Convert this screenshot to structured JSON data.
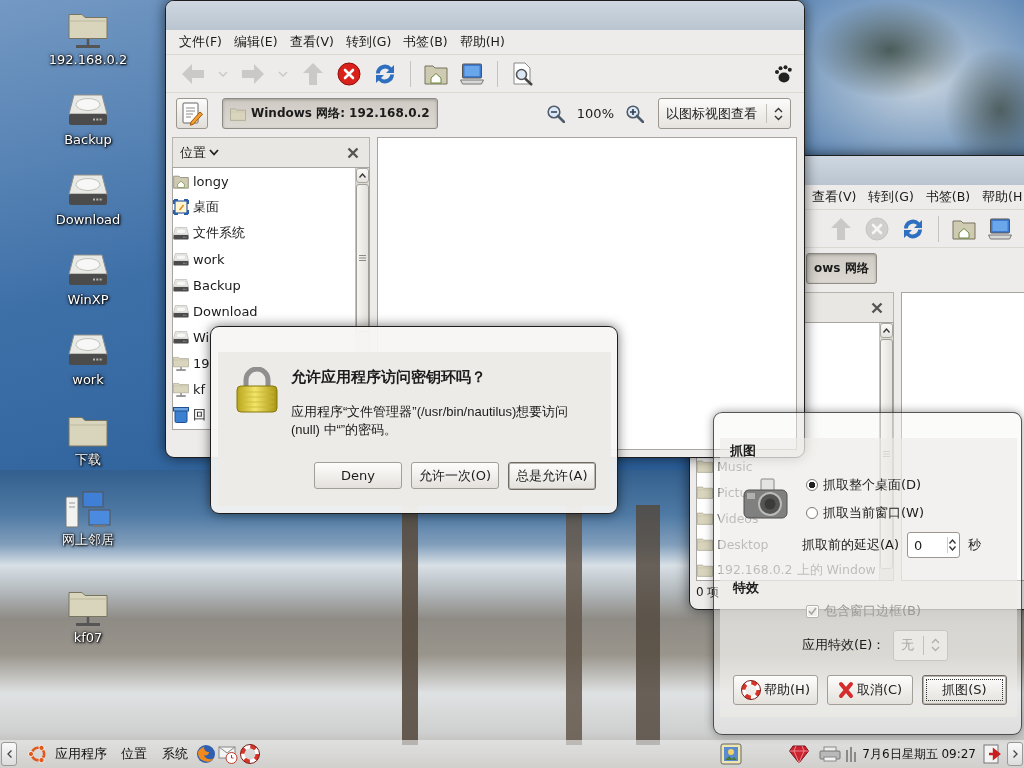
{
  "desktop": {
    "icons": [
      {
        "label": "192.168.0.2",
        "kind": "network-folder"
      },
      {
        "label": "Backup",
        "kind": "drive"
      },
      {
        "label": "Download",
        "kind": "drive"
      },
      {
        "label": "WinXP",
        "kind": "drive"
      },
      {
        "label": "work",
        "kind": "drive"
      },
      {
        "label": "下载",
        "kind": "folder"
      },
      {
        "label": "网上邻居",
        "kind": "network"
      },
      {
        "label": "kf07",
        "kind": "network-folder"
      }
    ]
  },
  "file_manager": {
    "menu": [
      "文件(F)",
      "编辑(E)",
      "查看(V)",
      "转到(G)",
      "书签(B)",
      "帮助(H)"
    ],
    "toolbar": [
      [
        {
          "kind": "back",
          "disabled": true
        },
        {
          "kind": "back-menu",
          "disabled": true
        },
        {
          "kind": "forward",
          "disabled": true
        },
        {
          "kind": "forward-menu",
          "disabled": true
        },
        {
          "kind": "up",
          "disabled": true
        },
        {
          "kind": "stop",
          "disabled": false
        },
        {
          "kind": "reload",
          "disabled": false
        }
      ],
      [
        {
          "kind": "home",
          "disabled": false
        },
        {
          "kind": "computer",
          "disabled": false
        }
      ],
      [
        {
          "kind": "search",
          "disabled": false
        }
      ]
    ],
    "path_button": {
      "label": "Windows 网络: 192.168.0.2",
      "selected": true
    },
    "zoom": "100%",
    "view_mode": "以图标视图查看",
    "sidebar": {
      "title": "位置",
      "items": [
        {
          "label": "longy",
          "kind": "home"
        },
        {
          "label": "桌面",
          "kind": "desktop"
        },
        {
          "label": "文件系统",
          "kind": "drive"
        },
        {
          "label": "work",
          "kind": "drive"
        },
        {
          "label": "Backup",
          "kind": "drive"
        },
        {
          "label": "Download",
          "kind": "drive"
        },
        {
          "label": "Wi",
          "kind": "drive"
        },
        {
          "label": "19",
          "kind": "network-folder"
        },
        {
          "label": "kf",
          "kind": "network-folder"
        },
        {
          "label": "回",
          "kind": "trash"
        }
      ]
    }
  },
  "back_window": {
    "menu": [
      "查看(V)",
      "转到(G)",
      "书签(B)",
      "帮助(H"
    ],
    "toolbar": [
      [
        {
          "kind": "up",
          "disabled": true
        },
        {
          "kind": "stop",
          "disabled": true
        },
        {
          "kind": "reload",
          "disabled": false
        }
      ],
      [
        {
          "kind": "home",
          "disabled": false
        },
        {
          "kind": "computer",
          "disabled": false
        }
      ]
    ],
    "path_button": {
      "label": "ows 网络",
      "selected": true
    },
    "sidebar_items": [
      {
        "label": "Music",
        "kind": "folder"
      },
      {
        "label": "Pictu",
        "kind": "folder"
      },
      {
        "label": "Videos",
        "kind": "folder"
      },
      {
        "label": "Desktop",
        "kind": "folder"
      },
      {
        "label": "192.168.0.2 上的 Window",
        "kind": "folder"
      }
    ],
    "status": "0 项"
  },
  "keyring_dialog": {
    "title": "允许应用程序访问密钥环吗？",
    "message": "应用程序“文件管理器”(/usr/bin/nautilus)想要访问 (null) 中“”的密码。",
    "buttons": [
      {
        "label": "Deny",
        "default": false
      },
      {
        "label": "允许一次(O)",
        "default": false
      },
      {
        "label": "总是允许(A)",
        "default": true
      }
    ]
  },
  "screenshot_dialog": {
    "capture_heading": "抓图",
    "options": [
      {
        "label": "抓取整个桌面(D)",
        "selected": true
      },
      {
        "label": "抓取当前窗口(W)",
        "selected": false
      }
    ],
    "delay_label": "抓取前的延迟(A)",
    "delay_value": "0",
    "delay_unit": "秒",
    "effects_heading": "特效",
    "border_checkbox": {
      "label": "包含窗口边框(B)",
      "checked": true,
      "disabled": true
    },
    "effect_label": "应用特效(E)：",
    "effect_select": {
      "value": "无",
      "disabled": true
    },
    "buttons": [
      {
        "label": "帮助(H)",
        "kind": "help",
        "default": false
      },
      {
        "label": "取消(C)",
        "kind": "cancel",
        "default": false
      },
      {
        "label": "抓图(S)",
        "kind": "grab",
        "default": true
      }
    ]
  },
  "panel": {
    "menus": [
      "应用程序",
      "位置",
      "系统"
    ],
    "clock": "7月6日星期五 09:27"
  }
}
